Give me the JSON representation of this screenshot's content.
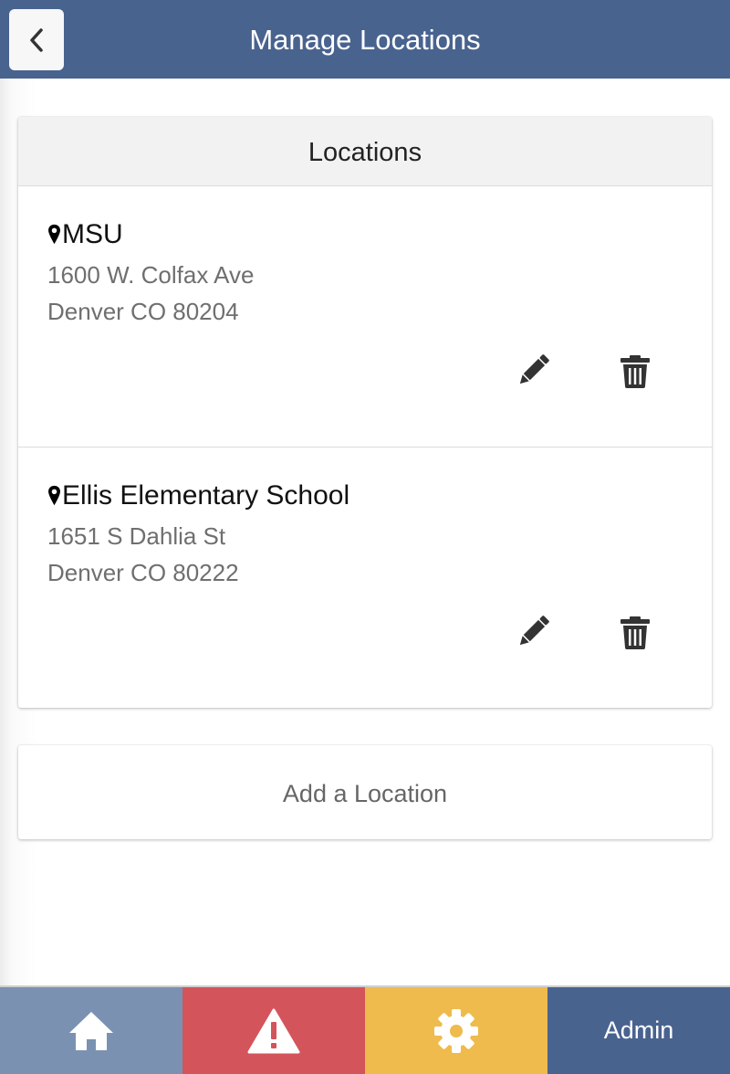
{
  "header": {
    "title": "Manage Locations",
    "back_icon": "chevron-left-icon",
    "background": "#49638f"
  },
  "locations_card": {
    "title": "Locations",
    "items": [
      {
        "name": "MSU",
        "address_line1": "1600 W. Colfax Ave",
        "address_line2": "Denver CO 80204",
        "edit_icon": "pencil-icon",
        "delete_icon": "trash-icon"
      },
      {
        "name": "Ellis Elementary School",
        "address_line1": "1651 S Dahlia St",
        "address_line2": "Denver CO 80222",
        "edit_icon": "pencil-icon",
        "delete_icon": "trash-icon"
      }
    ]
  },
  "add_location": {
    "label": "Add a Location"
  },
  "footer": {
    "tabs": [
      {
        "id": "home",
        "icon": "home-icon",
        "color": "#7a91b2"
      },
      {
        "id": "alerts",
        "icon": "warning-icon",
        "color": "#d4545b"
      },
      {
        "id": "settings",
        "icon": "gear-icon",
        "color": "#eebb4c"
      },
      {
        "id": "admin",
        "label": "Admin",
        "color": "#49638f"
      }
    ]
  }
}
